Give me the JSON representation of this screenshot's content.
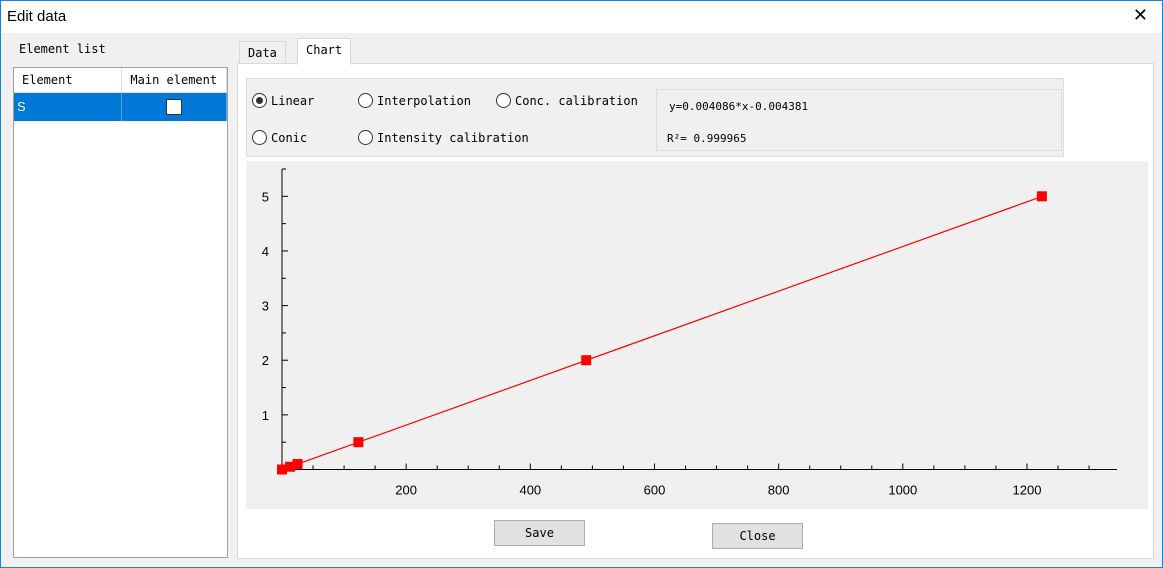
{
  "window": {
    "title": "Edit data",
    "close_icon": "close-icon"
  },
  "element_list": {
    "label": "Element list",
    "columns": [
      "Element",
      "Main element"
    ],
    "rows": [
      {
        "element": "S",
        "main_element": false,
        "selected": true
      }
    ]
  },
  "tabs": [
    {
      "label": "Data",
      "active": false
    },
    {
      "label": "Chart",
      "active": true
    }
  ],
  "fit_options": [
    {
      "label": "Linear",
      "selected": true
    },
    {
      "label": "Interpolation",
      "selected": false
    },
    {
      "label": "Conc. calibration",
      "selected": false
    },
    {
      "label": "Conic",
      "selected": false
    },
    {
      "label": "Intensity calibration",
      "selected": false
    }
  ],
  "equation": "y=0.004086*x-0.004381",
  "r_squared": "R²=  0.999965",
  "buttons": {
    "save": "Save",
    "close": "Close"
  },
  "chart_data": {
    "type": "scatter",
    "fit_line": "linear",
    "xlim": [
      0,
      1345
    ],
    "ylim": [
      0,
      5.5
    ],
    "xticks": [
      "200",
      "400",
      "600",
      "800",
      "1000",
      "1200"
    ],
    "yticks": [
      "1",
      "2",
      "3",
      "4",
      "5"
    ],
    "points": [
      {
        "x": 0,
        "y": 0
      },
      {
        "x": 13,
        "y": 0.05
      },
      {
        "x": 25,
        "y": 0.1
      },
      {
        "x": 123,
        "y": 0.5
      },
      {
        "x": 490,
        "y": 2
      },
      {
        "x": 1224,
        "y": 5
      }
    ],
    "colors": {
      "marker": "#ff0000",
      "line": "#ff0000"
    },
    "grid": false
  }
}
